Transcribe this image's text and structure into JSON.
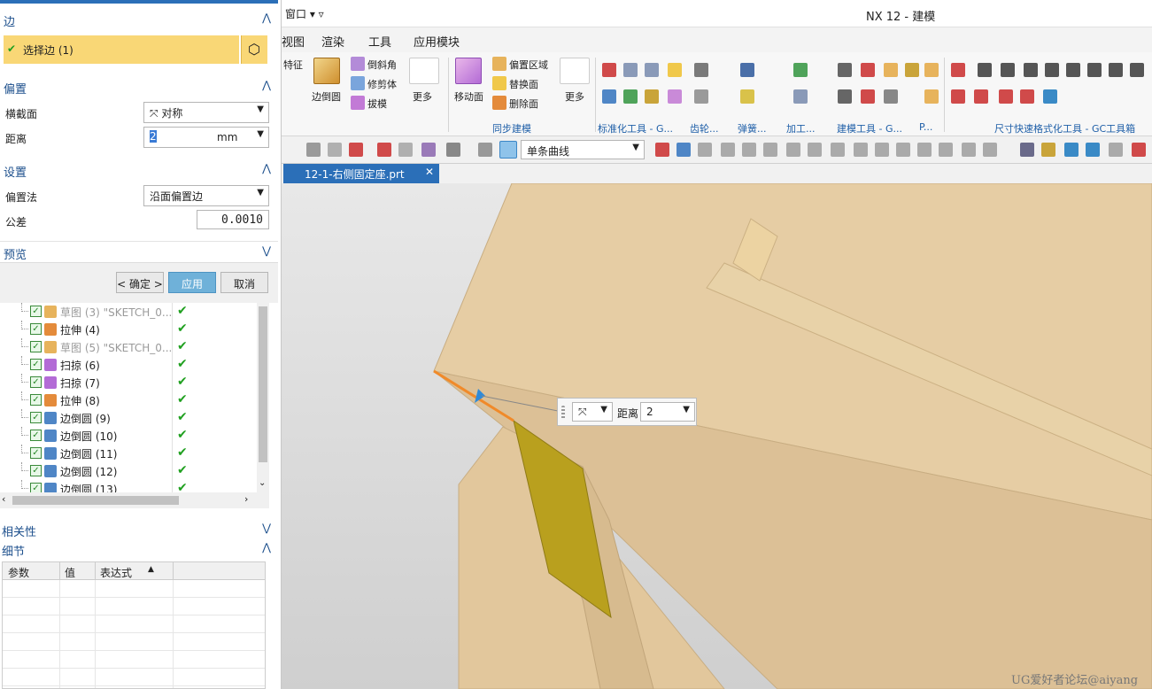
{
  "window": {
    "menu_label": "窗口 ▾ ▿",
    "title": "NX 12 - 建模"
  },
  "menubar": {
    "items": [
      "视图",
      "渲染",
      "工具",
      "应用模块"
    ]
  },
  "ribbon": {
    "feature_label": "特征",
    "edge_blend": "边倒圆",
    "chamfer": "倒斜角",
    "trim_body": "修剪体",
    "draft": "拔模",
    "more1": "更多",
    "move_face": "移动面",
    "offset_region": "偏置区域",
    "replace_face": "替换面",
    "delete_face": "删除面",
    "more2": "更多",
    "groups": [
      "同步建模",
      "标准化工具 - G...",
      "齿轮...",
      "弹簧...",
      "加工...",
      "建模工具 - G...",
      "P...",
      "尺寸快速格式化工具 - GC工具箱"
    ]
  },
  "toolbar2": {
    "curve_rule": "单条曲线"
  },
  "tab": {
    "filename": "12-1-右侧固定座.prt"
  },
  "dialog": {
    "edge_section": "边",
    "select_edge": "选择边 (1)",
    "offset_section": "偏置",
    "cross_section_label": "横截面",
    "cross_section_value": "对称",
    "distance_label": "距离",
    "distance_value": "2",
    "distance_unit": "mm",
    "settings_section": "设置",
    "offset_method_label": "偏置法",
    "offset_method_value": "沿面偏置边",
    "tolerance_label": "公差",
    "tolerance_value": "0.0010",
    "preview_section": "预览",
    "ok_button": "< 确定 >",
    "apply_button": "应用",
    "cancel_button": "取消"
  },
  "tree": {
    "rows": [
      {
        "name": "草图 (3) \"SKETCH_0...",
        "dim": true
      },
      {
        "name": "拉伸 (4)",
        "dim": false
      },
      {
        "name": "草图 (5) \"SKETCH_0...",
        "dim": true
      },
      {
        "name": "扫掠 (6)",
        "dim": false
      },
      {
        "name": "扫掠 (7)",
        "dim": false
      },
      {
        "name": "拉伸 (8)",
        "dim": false
      },
      {
        "name": "边倒圆 (9)",
        "dim": false
      },
      {
        "name": "边倒圆 (10)",
        "dim": false
      },
      {
        "name": "边倒圆 (11)",
        "dim": false
      },
      {
        "name": "边倒圆 (12)",
        "dim": false
      },
      {
        "name": "边倒圆 (13)",
        "dim": false
      }
    ]
  },
  "dependencies": {
    "title": "相关性"
  },
  "details": {
    "title": "细节",
    "columns": [
      "参数",
      "值",
      "表达式"
    ]
  },
  "onscreen": {
    "distance_label": "距离",
    "distance_value": "2"
  },
  "watermark": "UG爱好者论坛@aiyang",
  "colors": {
    "accent": "#2b6fb8",
    "select_row": "#f9d776",
    "apply_btn": "#6fb1d9",
    "part_face": "#e2c79c",
    "offset_face": "#b9a01e"
  }
}
